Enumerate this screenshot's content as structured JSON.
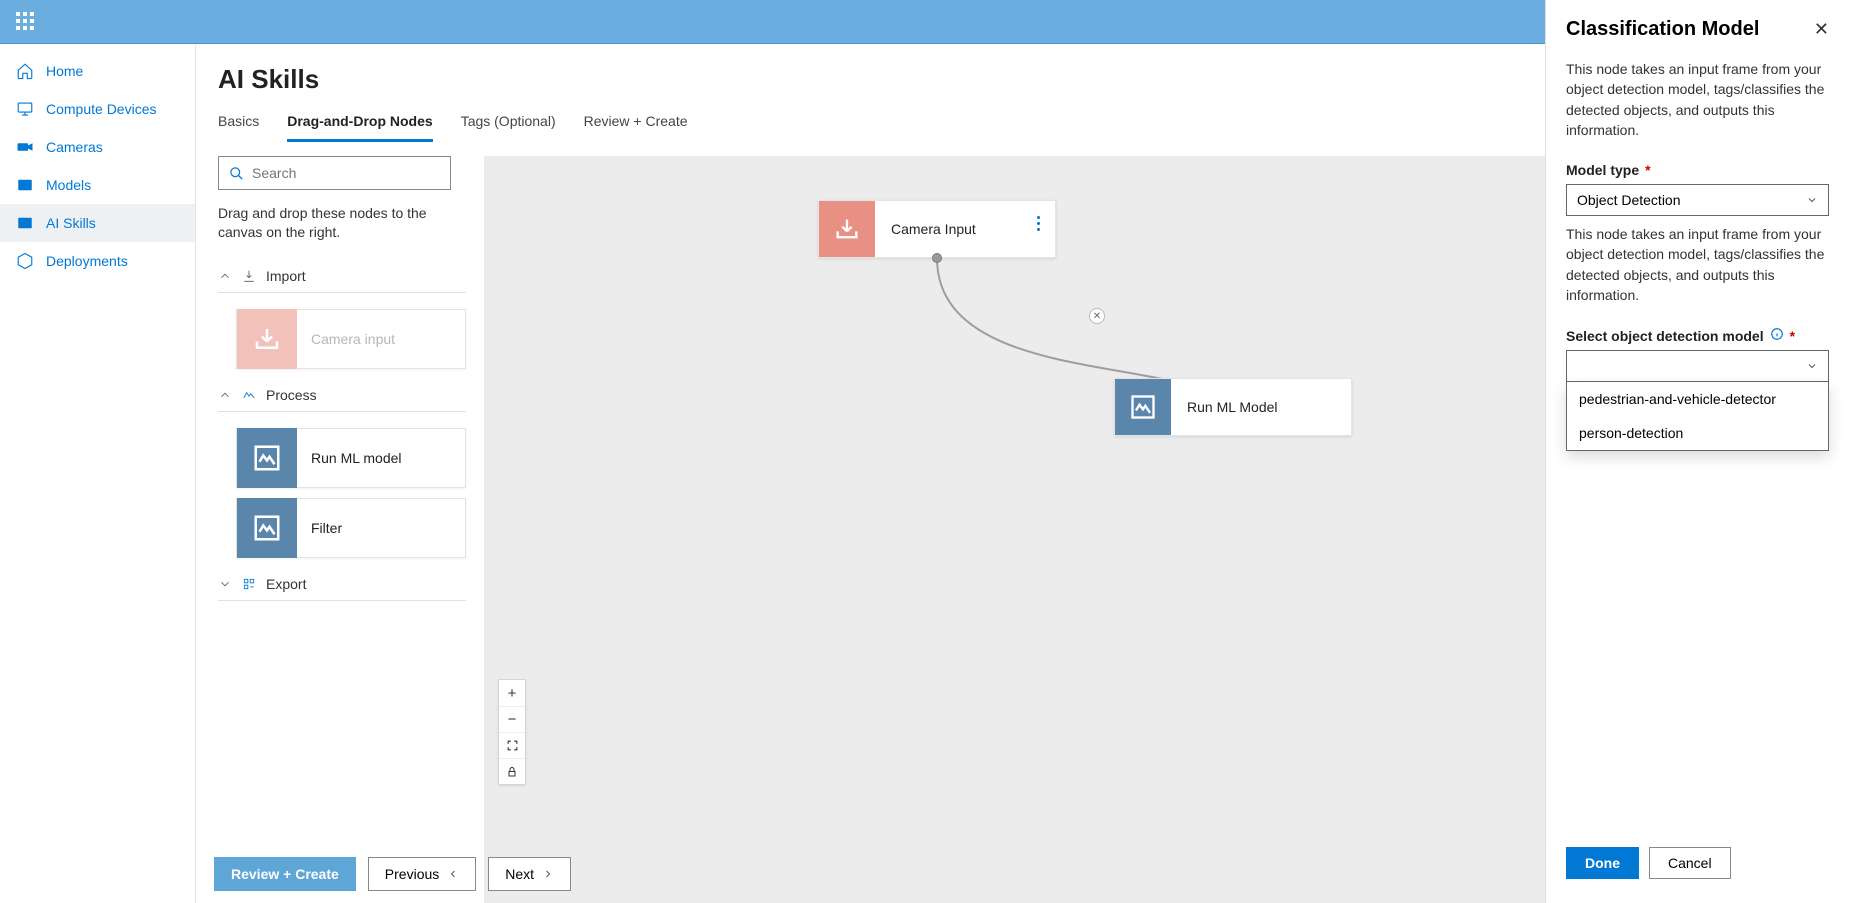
{
  "sidebar": {
    "items": [
      {
        "label": "Home"
      },
      {
        "label": "Compute Devices"
      },
      {
        "label": "Cameras"
      },
      {
        "label": "Models"
      },
      {
        "label": "AI Skills"
      },
      {
        "label": "Deployments"
      }
    ]
  },
  "page": {
    "title": "AI Skills"
  },
  "tabs": [
    {
      "label": "Basics"
    },
    {
      "label": "Drag-and-Drop Nodes"
    },
    {
      "label": "Tags (Optional)"
    },
    {
      "label": "Review + Create"
    }
  ],
  "palette": {
    "search_placeholder": "Search",
    "hint": "Drag and drop these nodes to the canvas on the right.",
    "groups": {
      "import": {
        "label": "Import",
        "nodes": [
          {
            "label": "Camera input"
          }
        ]
      },
      "process": {
        "label": "Process",
        "nodes": [
          {
            "label": "Run ML model"
          },
          {
            "label": "Filter"
          }
        ]
      },
      "export": {
        "label": "Export"
      }
    }
  },
  "canvas": {
    "nodes": {
      "camera": {
        "label": "Camera Input"
      },
      "model": {
        "label": "Run ML Model"
      }
    }
  },
  "footer": {
    "review": "Review + Create",
    "prev": "Previous",
    "next": "Next"
  },
  "panel": {
    "title": "Classification Model",
    "desc": "This node takes an input frame from your object detection model, tags/classifies the detected objects, and outputs this information.",
    "model_type_label": "Model type",
    "model_type_value": "Object Detection",
    "model_type_desc": "This node takes an input frame from your object detection model, tags/classifies the detected objects, and outputs this information.",
    "select_model_label": "Select object detection model",
    "select_model_value": "",
    "options": [
      "pedestrian-and-vehicle-detector",
      "person-detection"
    ],
    "done": "Done",
    "cancel": "Cancel"
  }
}
